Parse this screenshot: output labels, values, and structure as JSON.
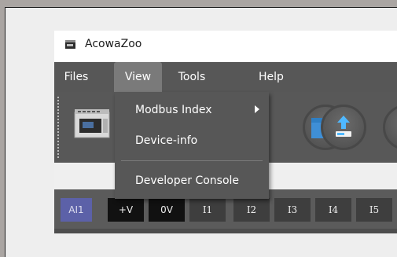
{
  "window": {
    "title": "AcowaZoo",
    "icon": "device-icon"
  },
  "menubar": {
    "items": [
      {
        "label": "Files"
      },
      {
        "label": "View",
        "active": true
      },
      {
        "label": "Tools"
      },
      {
        "label": "Help"
      }
    ]
  },
  "toolbar": {
    "icons": [
      "device-thumbnail-icon",
      "folder-icon",
      "upload-icon"
    ]
  },
  "view_menu": {
    "items": [
      {
        "label": "Modbus Index",
        "has_submenu": true
      },
      {
        "label": "Device-info"
      },
      {
        "label": "Developer Console"
      }
    ]
  },
  "terminals": [
    "AI1",
    "+V",
    "0V",
    "I1",
    "I2",
    "I3",
    "I4",
    "I5"
  ],
  "colors": {
    "menubar": "#575757",
    "active_menu": "#7a7a7a",
    "folder": "#2f7fc4",
    "ai1": "#5c61a8"
  }
}
